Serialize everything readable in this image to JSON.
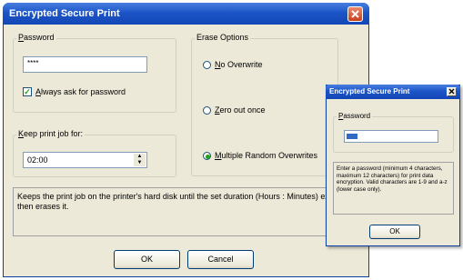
{
  "main_window": {
    "title": "Encrypted Secure Print",
    "password_group": {
      "legend_prefix": "P",
      "legend_rest": "assword",
      "value": "****",
      "always_ask_prefix": "A",
      "always_ask_rest": "lways ask for password",
      "always_ask_checked": true
    },
    "keep_group": {
      "legend_prefix": "K",
      "legend_rest": "eep print job for:",
      "value": "02:00"
    },
    "erase_group": {
      "legend": "Erase Options",
      "options": [
        {
          "prefix": "N",
          "rest": "o Overwrite",
          "selected": false
        },
        {
          "prefix": "Z",
          "rest": "ero out once",
          "selected": false
        },
        {
          "prefix": "M",
          "rest": "ultiple Random Overwrites",
          "selected": true
        }
      ]
    },
    "description": "Keeps the print job on the printer's hard disk until the set duration (Hours : Minutes) ex then erases it.",
    "ok_label": "OK",
    "cancel_label": "Cancel"
  },
  "popup_window": {
    "title": "Encrypted Secure Print",
    "password_legend_prefix": "P",
    "password_legend_rest": "assword",
    "info_text": "Enter a password (minimum 4 characters, maximum 12 characters) for print data encryption. Valid characters are 1-9 and a-z (lower case only).",
    "ok_label": "OK"
  }
}
